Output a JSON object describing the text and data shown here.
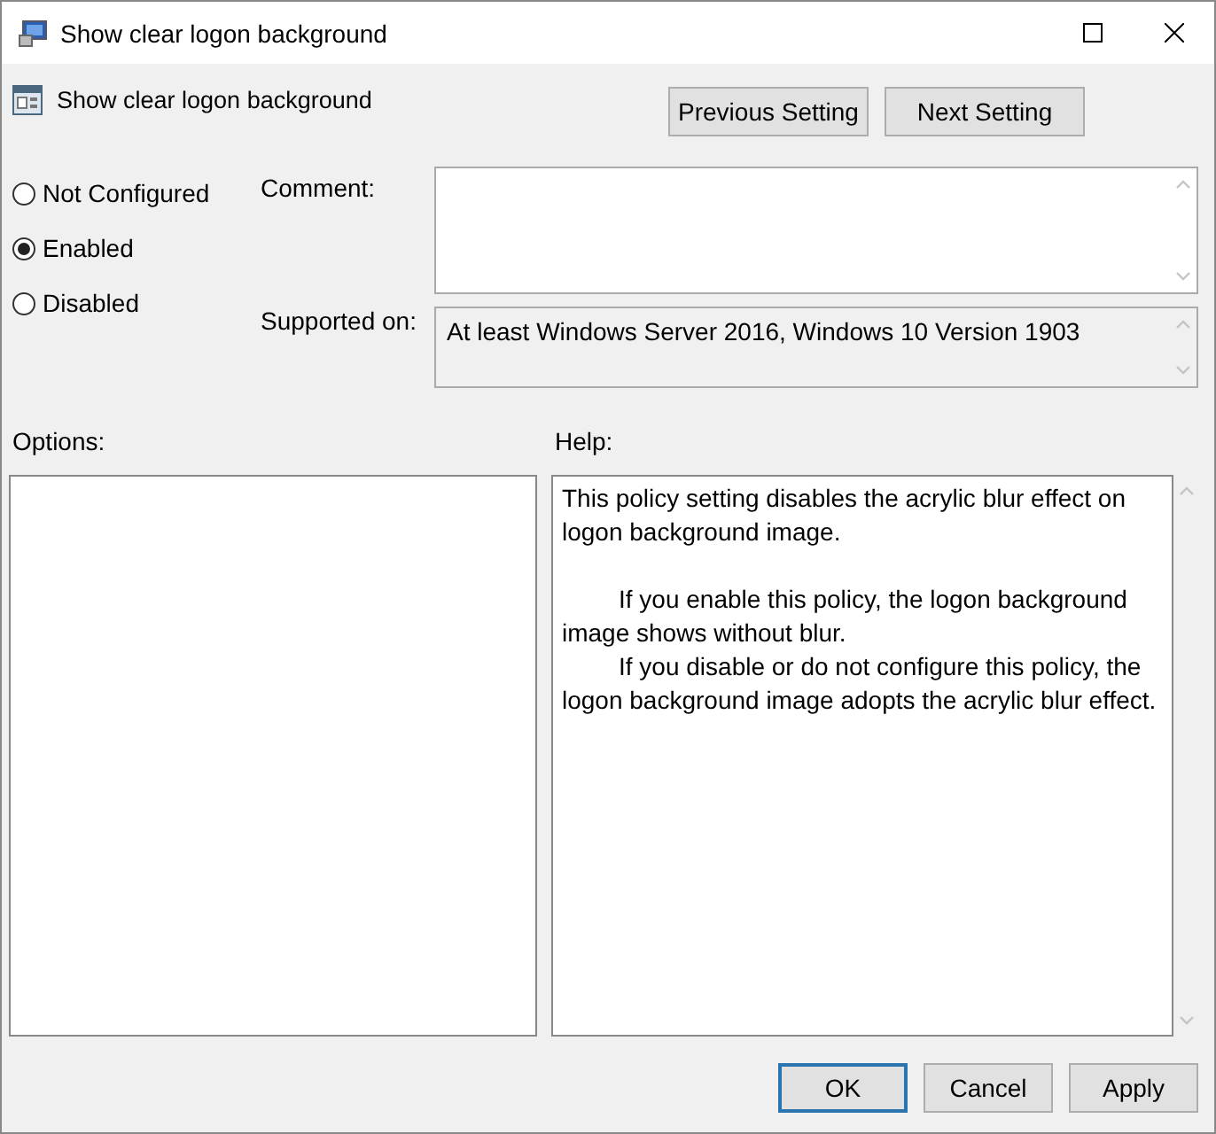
{
  "window": {
    "title": "Show clear logon background"
  },
  "setting": {
    "name": "Show clear logon background"
  },
  "nav_buttons": [
    "Previous Setting",
    "Next Setting"
  ],
  "states": [
    {
      "label": "Not Configured",
      "selected": false
    },
    {
      "label": "Enabled",
      "selected": true
    },
    {
      "label": "Disabled",
      "selected": false
    }
  ],
  "comment": {
    "label": "Comment:"
  },
  "supported_on": {
    "label": "Supported on:",
    "value": "At least Windows Server 2016, Windows 10 Version 1903"
  },
  "options": {
    "label": "Options:"
  },
  "help": {
    "label": "Help:",
    "paragraphs": [
      {
        "text": "This policy setting disables the acrylic blur effect on logon background image.",
        "indented": false
      },
      {
        "text": "If you enable this policy, the logon background image shows without blur.",
        "indented": true
      },
      {
        "text": "If you disable or do not configure this policy, the logon background image adopts the acrylic blur effect.",
        "indented": true
      }
    ]
  },
  "buttons": [
    {
      "label": "OK",
      "default": true
    },
    {
      "label": "Cancel",
      "default": false
    },
    {
      "label": "Apply",
      "default": false
    }
  ]
}
